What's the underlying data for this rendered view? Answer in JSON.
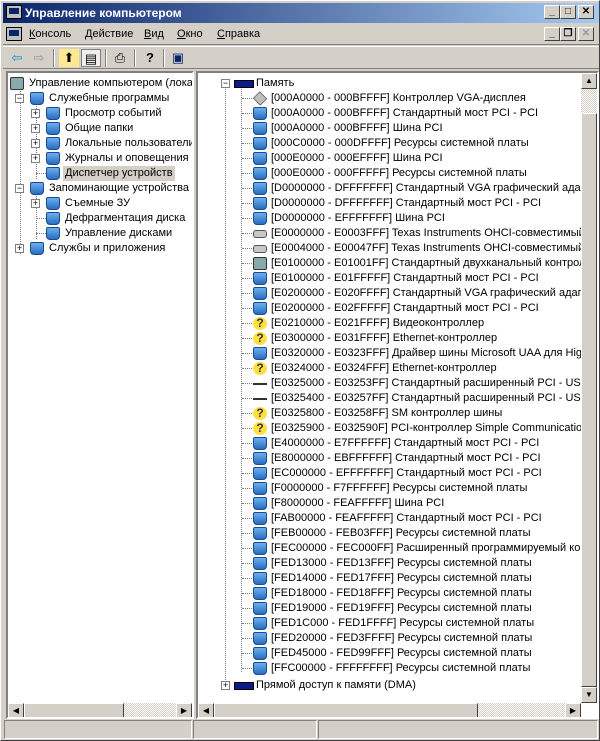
{
  "window": {
    "title": "Управление компьютером",
    "minimize": "_",
    "maximize": "□",
    "close": "✕",
    "child_minimize": "_",
    "child_restore": "❐",
    "child_close": "✕"
  },
  "menu": [
    {
      "first": "К",
      "rest": "онсоль"
    },
    {
      "first": "Д",
      "rest": "ействие"
    },
    {
      "first": "В",
      "rest": "ид"
    },
    {
      "first": "О",
      "rest": "кно"
    },
    {
      "first": "С",
      "rest": "правка"
    }
  ],
  "toolbar": {
    "back": "⇦",
    "forward": "⇨",
    "up": "⬆",
    "show_hide_tree": "▤",
    "print": "⎙",
    "help": "?",
    "properties": "▣"
  },
  "left_tree": [
    {
      "label": "Управление компьютером (локальным)",
      "level": 0,
      "icon": "computer-icon",
      "expander": ""
    },
    {
      "label": "Служебные программы",
      "level": 1,
      "icon": "tools-icon",
      "expander": "−"
    },
    {
      "label": "Просмотр событий",
      "level": 2,
      "icon": "event-viewer-icon",
      "expander": "+"
    },
    {
      "label": "Общие папки",
      "level": 2,
      "icon": "shared-folders-icon",
      "expander": "+"
    },
    {
      "label": "Локальные пользователи",
      "level": 2,
      "icon": "users-icon",
      "expander": "+"
    },
    {
      "label": "Журналы и оповещения производительности",
      "level": 2,
      "icon": "performance-logs-icon",
      "expander": "+"
    },
    {
      "label": "Диспетчер устройств",
      "level": 2,
      "icon": "device-manager-icon",
      "expander": "",
      "selected": true
    },
    {
      "label": "Запоминающие устройства",
      "level": 1,
      "icon": "storage-icon",
      "expander": "−"
    },
    {
      "label": "Съемные ЗУ",
      "level": 2,
      "icon": "removable-storage-icon",
      "expander": "+"
    },
    {
      "label": "Дефрагментация диска",
      "level": 2,
      "icon": "defrag-icon",
      "expander": ""
    },
    {
      "label": "Управление дисками",
      "level": 2,
      "icon": "disk-management-icon",
      "expander": ""
    },
    {
      "label": "Службы и приложения",
      "level": 1,
      "icon": "services-icon",
      "expander": "+"
    }
  ],
  "right_tree": {
    "root": {
      "label": "Память",
      "expander": "−",
      "icon": "memory-icon"
    },
    "items": [
      {
        "range": "[000A0000 - 000BFFFF]",
        "name": "Контроллер VGA-дисплея",
        "icon": "vga"
      },
      {
        "range": "[000A0000 - 000BFFFF]",
        "name": "Стандартный мост PCI - PCI",
        "icon": "pc"
      },
      {
        "range": "[000A0000 - 000BFFFF]",
        "name": "Шина PCI",
        "icon": "pc"
      },
      {
        "range": "[000C0000 - 000DFFFF]",
        "name": "Ресурсы системной платы",
        "icon": "pc"
      },
      {
        "range": "[000E0000 - 000EFFFF]",
        "name": "Шина PCI",
        "icon": "pc"
      },
      {
        "range": "[000E0000 - 000FFFFF]",
        "name": "Ресурсы системной платы",
        "icon": "pc"
      },
      {
        "range": "[D0000000 - DFFFFFFF]",
        "name": "Стандартный VGA графический адаптер",
        "icon": "pc"
      },
      {
        "range": "[D0000000 - DFFFFFFF]",
        "name": "Стандартный мост PCI - PCI",
        "icon": "pc"
      },
      {
        "range": "[D0000000 - EFFFFFFF]",
        "name": "Шина PCI",
        "icon": "pc"
      },
      {
        "range": "[E0000000 - E0003FFF]",
        "name": "Texas Instruments OHCI-совместимый IEEE 1394",
        "icon": "chip"
      },
      {
        "range": "[E0004000 - E00047FF]",
        "name": "Texas Instruments OHCI-совместимый IEEE 1394",
        "icon": "chip"
      },
      {
        "range": "[E0100000 - E01001FF]",
        "name": "Стандартный двухканальный контроллер",
        "icon": "gen"
      },
      {
        "range": "[E0100000 - E01FFFFF]",
        "name": "Стандартный мост PCI - PCI",
        "icon": "pc"
      },
      {
        "range": "[E0200000 - E020FFFF]",
        "name": "Стандартный VGA графический адаптер",
        "icon": "pc"
      },
      {
        "range": "[E0200000 - E02FFFFF]",
        "name": "Стандартный мост PCI - PCI",
        "icon": "pc"
      },
      {
        "range": "[E0210000 - E021FFFF]",
        "name": "Видеоконтроллер",
        "icon": "q"
      },
      {
        "range": "[E0300000 - E031FFFF]",
        "name": "Ethernet-контроллер",
        "icon": "q"
      },
      {
        "range": "[E0320000 - E0323FFF]",
        "name": "Драйвер шины Microsoft UAA для High Definition Audio",
        "icon": "pc"
      },
      {
        "range": "[E0324000 - E0324FFF]",
        "name": "Ethernet-контроллер",
        "icon": "q"
      },
      {
        "range": "[E0325000 - E03253FF]",
        "name": "Стандартный расширенный PCI - USB хост-контроллер",
        "icon": "usb"
      },
      {
        "range": "[E0325400 - E03257FF]",
        "name": "Стандартный расширенный PCI - USB хост-контроллер",
        "icon": "usb"
      },
      {
        "range": "[E0325800 - E03258FF]",
        "name": "SM контроллер шины",
        "icon": "q"
      },
      {
        "range": "[E0325900 - E032590F]",
        "name": "PCI-контроллер Simple Communications",
        "icon": "q"
      },
      {
        "range": "[E4000000 - E7FFFFFF]",
        "name": "Стандартный мост PCI - PCI",
        "icon": "pc"
      },
      {
        "range": "[E8000000 - EBFFFFFF]",
        "name": "Стандартный мост PCI - PCI",
        "icon": "pc"
      },
      {
        "range": "[EC000000 - EFFFFFFF]",
        "name": "Стандартный мост PCI - PCI",
        "icon": "pc"
      },
      {
        "range": "[F0000000 - F7FFFFFF]",
        "name": "Ресурсы системной платы",
        "icon": "pc"
      },
      {
        "range": "[F8000000 - FEAFFFFF]",
        "name": "Шина PCI",
        "icon": "pc"
      },
      {
        "range": "[FAB00000 - FEAFFFFF]",
        "name": "Стандартный мост PCI - PCI",
        "icon": "pc"
      },
      {
        "range": "[FEB00000 - FEB03FFF]",
        "name": "Ресурсы системной платы",
        "icon": "pc"
      },
      {
        "range": "[FEC00000 - FEC000FF]",
        "name": "Расширенный программируемый контроллер прерываний",
        "icon": "pc"
      },
      {
        "range": "[FED13000 - FED13FFF]",
        "name": "Ресурсы системной платы",
        "icon": "pc"
      },
      {
        "range": "[FED14000 - FED17FFF]",
        "name": "Ресурсы системной платы",
        "icon": "pc"
      },
      {
        "range": "[FED18000 - FED18FFF]",
        "name": "Ресурсы системной платы",
        "icon": "pc"
      },
      {
        "range": "[FED19000 - FED19FFF]",
        "name": "Ресурсы системной платы",
        "icon": "pc"
      },
      {
        "range": "[FED1C000 - FED1FFFF]",
        "name": "Ресурсы системной платы",
        "icon": "pc"
      },
      {
        "range": "[FED20000 - FED3FFFF]",
        "name": "Ресурсы системной платы",
        "icon": "pc"
      },
      {
        "range": "[FED45000 - FED99FFF]",
        "name": "Ресурсы системной платы",
        "icon": "pc"
      },
      {
        "range": "[FFC00000 - FFFFFFFF]",
        "name": "Ресурсы системной платы",
        "icon": "pc"
      }
    ],
    "after": {
      "label": "Прямой доступ к памяти (DMA)",
      "expander": "+",
      "icon": "memory-icon"
    }
  },
  "scroll": {
    "left": "◀",
    "right": "▶",
    "up": "▲",
    "down": "▼"
  }
}
